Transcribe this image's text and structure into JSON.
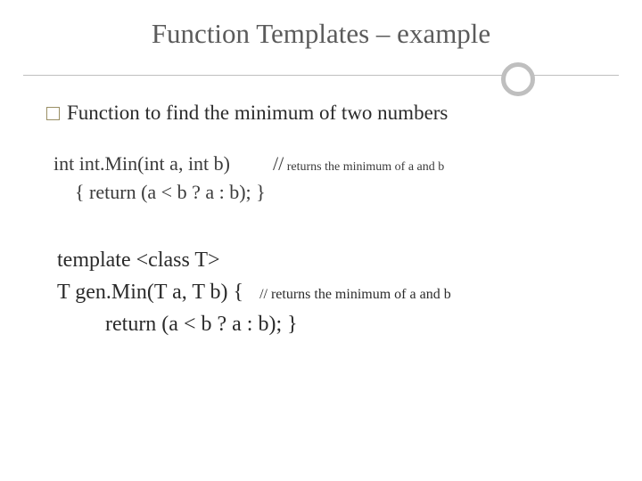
{
  "title": "Function Templates – example",
  "bullet": "Function to find the minimum of two numbers",
  "code1": {
    "line1_left": "int int.Min(int a, int b)",
    "line1_comment_lead": "//",
    "line1_comment_rest": " returns the minimum of a and b",
    "line2": "{ return (a < b ? a : b); }"
  },
  "code2": {
    "line1": "template <class T>",
    "line2_left": "T gen.Min(T a, T b) {",
    "line2_comment": "// returns the minimum of a and b",
    "line3": "return (a < b ? a : b); }"
  }
}
